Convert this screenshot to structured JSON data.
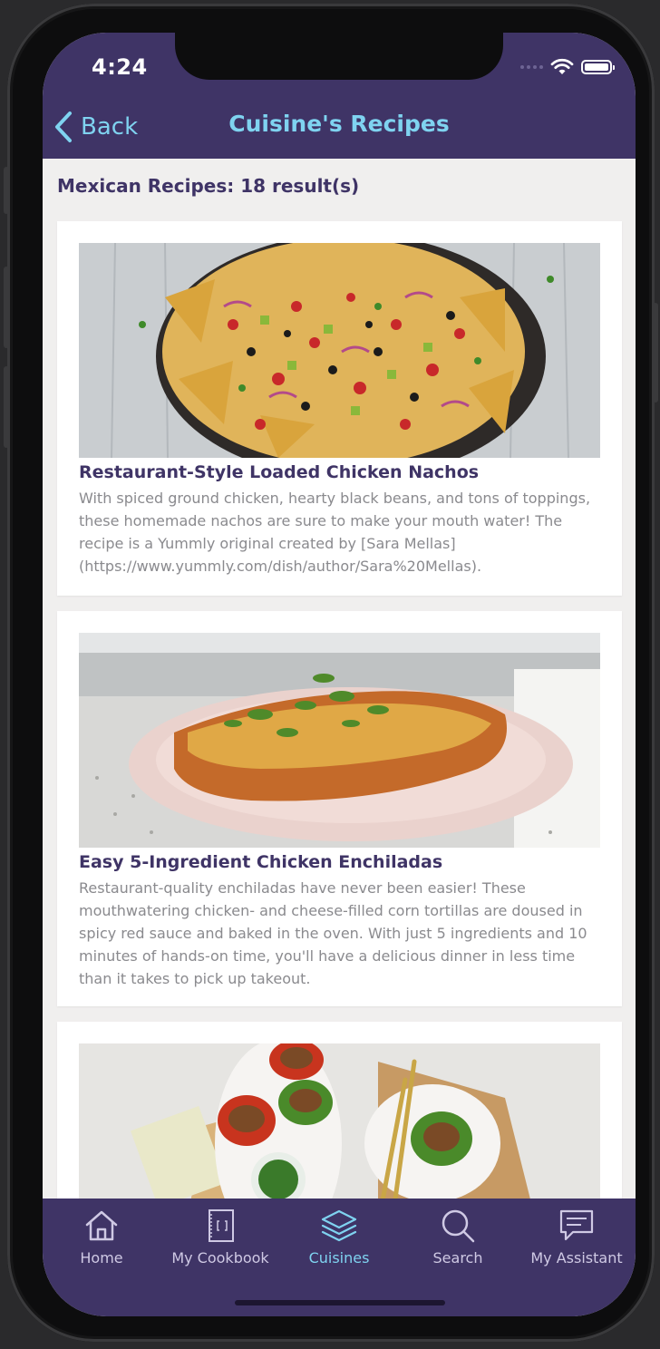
{
  "status_bar": {
    "time": "4:24"
  },
  "nav": {
    "back_label": "Back",
    "title": "Cuisine's Recipes"
  },
  "results": {
    "heading": "Mexican Recipes: 18 result(s)"
  },
  "recipes": [
    {
      "title": "Restaurant-Style Loaded Chicken Nachos",
      "description": "With spiced ground chicken, hearty black beans, and tons of toppings, these homemade nachos are sure to make your mouth water! The recipe is a Yummly original created by [Sara Mellas](https://www.yummly.com/dish/author/Sara%20Mellas)."
    },
    {
      "title": "Easy 5-Ingredient Chicken Enchiladas",
      "description": "Restaurant-quality enchiladas have never been easier! These mouthwatering chicken- and cheese-filled corn tortillas are doused in spicy red sauce and baked in the oven. With just 5 ingredients and 10 minutes of hands-on time, you'll have a delicious dinner in less time than it takes to pick up takeout."
    },
    {
      "title": "",
      "description": ""
    }
  ],
  "tabs": [
    {
      "label": "Home",
      "icon": "home-icon"
    },
    {
      "label": "My Cookbook",
      "icon": "cookbook-icon"
    },
    {
      "label": "Cuisines",
      "icon": "layers-icon"
    },
    {
      "label": "Search",
      "icon": "search-icon"
    },
    {
      "label": "My Assistant",
      "icon": "chat-icon"
    }
  ],
  "colors": {
    "brand": "#3f3466",
    "accent": "#7fd3f0",
    "background": "#f0efee",
    "description_text": "#8a8a8e"
  }
}
